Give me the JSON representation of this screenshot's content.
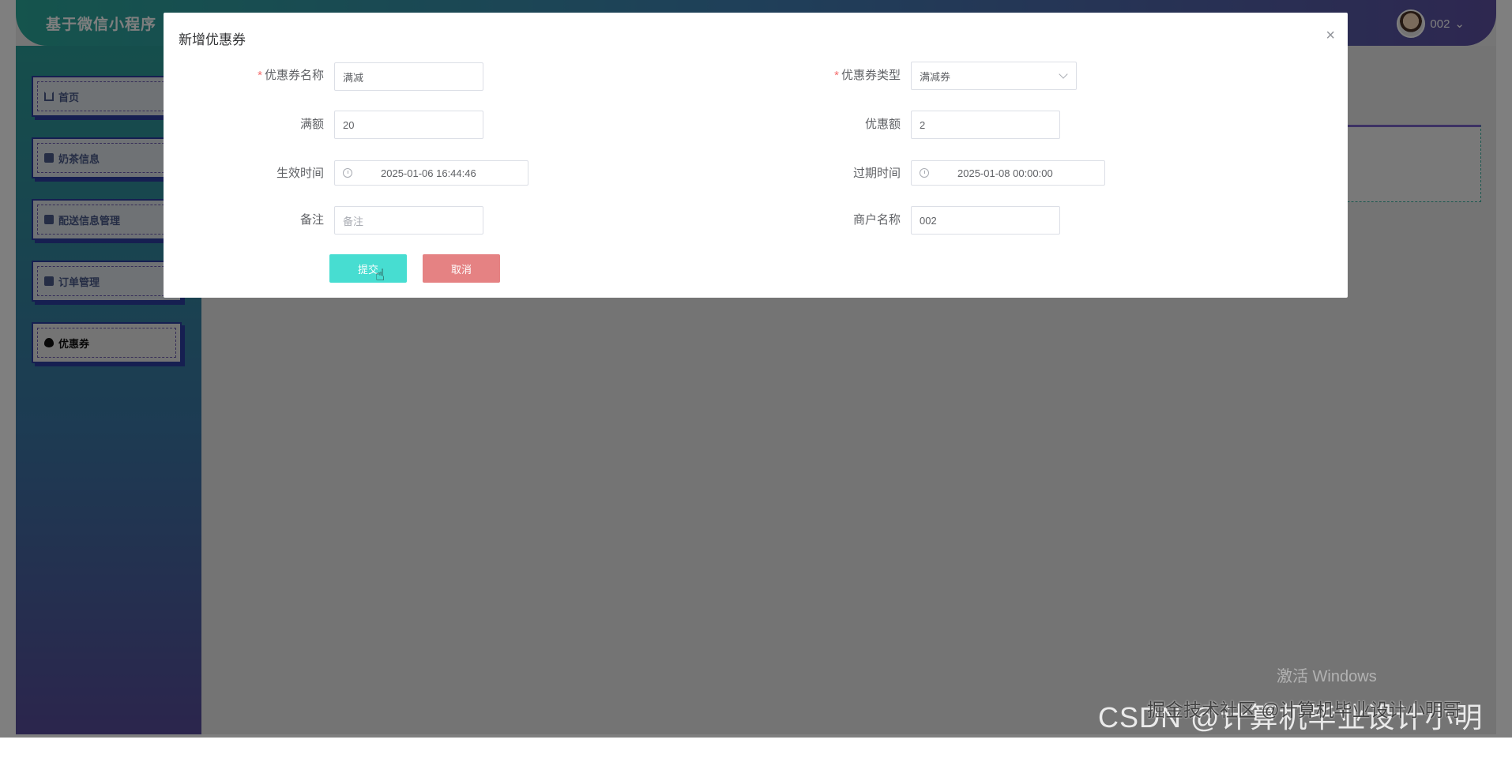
{
  "header": {
    "app_title": "基于微信小程序",
    "username": "002",
    "dropdown_arrow": "⌄"
  },
  "sidebar": {
    "items": [
      {
        "label": "首页",
        "icon": "home-icon"
      },
      {
        "label": "奶茶信息",
        "icon": "box-icon"
      },
      {
        "label": "配送信息管理",
        "icon": "box-icon"
      },
      {
        "label": "订单管理",
        "icon": "box-icon"
      },
      {
        "label": "优惠券",
        "icon": "drop-icon",
        "active": true
      }
    ]
  },
  "dialog": {
    "title": "新增优惠券",
    "close_label": "×",
    "fields": {
      "coupon_name": {
        "label": "优惠券名称",
        "value": "满减",
        "required": true
      },
      "coupon_type": {
        "label": "优惠券类型",
        "value": "满减券",
        "required": true
      },
      "threshold": {
        "label": "满额",
        "value": "20"
      },
      "discount": {
        "label": "优惠额",
        "value": "2"
      },
      "start_time": {
        "label": "生效时间",
        "value": "2025-01-06 16:44:46"
      },
      "expire_time": {
        "label": "过期时间",
        "value": "2025-01-08 00:00:00"
      },
      "remark": {
        "label": "备注",
        "placeholder": "备注"
      },
      "merchant_name": {
        "label": "商户名称",
        "value": "002"
      }
    },
    "required_mark": "*",
    "submit_label": "提交",
    "cancel_label": "取消"
  },
  "watermarks": {
    "windows": "激活 Windows",
    "juejin": "掘金技术社区 @计算机毕业设计小明哥",
    "csdn": "CSDN @计算机毕业设计小明哥"
  },
  "colors": {
    "submit": "#47ddd1",
    "cancel": "#e58283",
    "required": "#f56c6c"
  }
}
